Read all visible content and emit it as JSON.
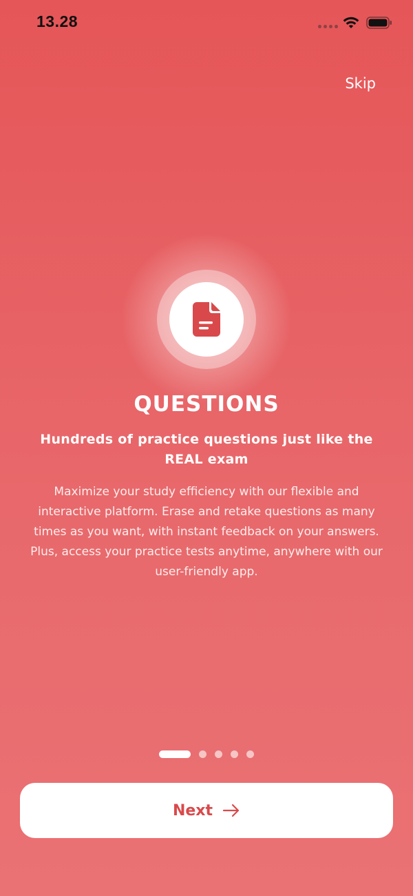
{
  "status_bar": {
    "time": "13.28"
  },
  "header": {
    "skip_label": "Skip"
  },
  "slide": {
    "icon": "document-icon",
    "title": "QUESTIONS",
    "subtitle": "Hundreds of practice questions just like the REAL exam",
    "description": "Maximize your study efficiency with our flexible and interactive platform. Erase and retake questions as many times as you want, with instant feedback on your answers. Plus, access your practice tests anytime, anywhere with our user-friendly app."
  },
  "pagination": {
    "total": 5,
    "current": 1
  },
  "footer": {
    "next_label": "Next",
    "next_icon": "arrow-right-icon"
  },
  "colors": {
    "accent": "#D9494B",
    "background_top": "#E55658",
    "background_bottom": "#EA7274"
  }
}
